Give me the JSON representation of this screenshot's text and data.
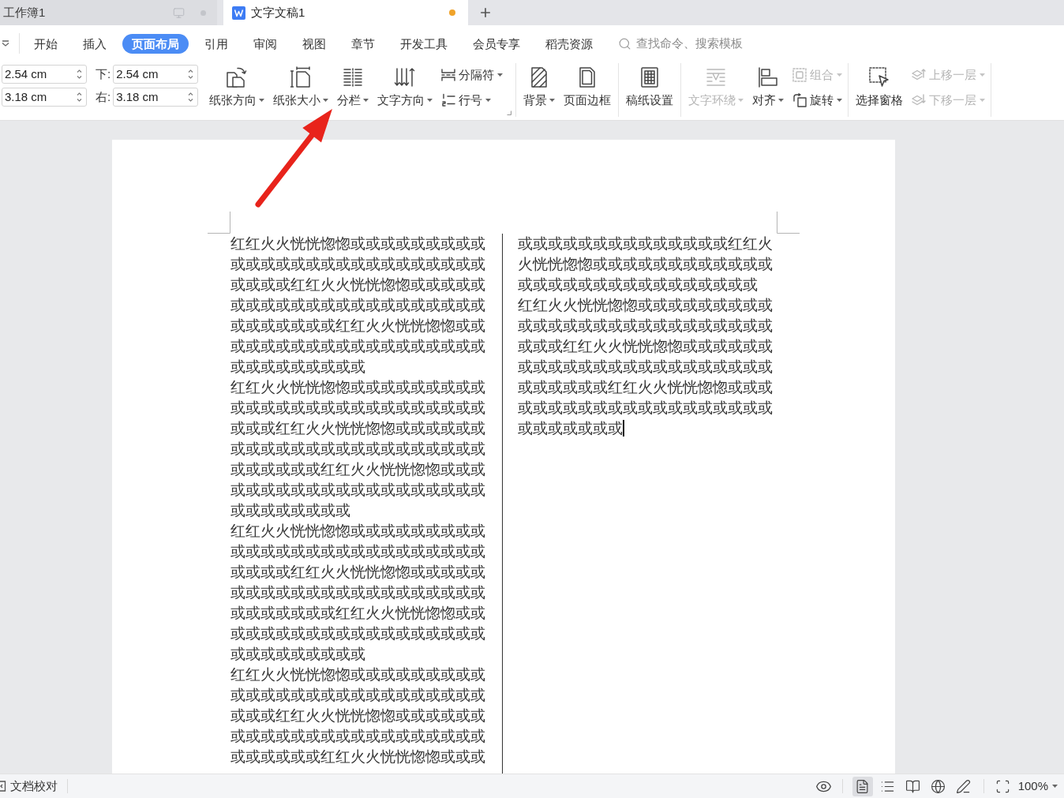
{
  "doc_tabs": [
    {
      "title": "工作簿1",
      "kind": "spreadsheet",
      "selected": false,
      "modified": false
    },
    {
      "title": "文字文稿1",
      "kind": "document",
      "selected": true,
      "modified": true
    }
  ],
  "ribbon_tabs": [
    {
      "label": "开始",
      "selected": false
    },
    {
      "label": "插入",
      "selected": false
    },
    {
      "label": "页面布局",
      "selected": true
    },
    {
      "label": "引用",
      "selected": false
    },
    {
      "label": "审阅",
      "selected": false
    },
    {
      "label": "视图",
      "selected": false
    },
    {
      "label": "章节",
      "selected": false
    },
    {
      "label": "开发工具",
      "selected": false
    },
    {
      "label": "会员专享",
      "selected": false
    },
    {
      "label": "稻壳资源",
      "selected": false
    }
  ],
  "search": {
    "placeholder": "查找命令、搜索模板"
  },
  "margins": [
    {
      "value": "2.54 cm"
    },
    {
      "value": "3.18 cm"
    },
    {
      "label": "下:",
      "value": "2.54 cm"
    },
    {
      "label": "右:",
      "value": "3.18 cm"
    }
  ],
  "ribbon_groups": [
    {
      "launcher": true,
      "items": [
        {
          "kind": "large",
          "label": "纸张方向",
          "dropdown": true,
          "disabled": false
        },
        {
          "kind": "large",
          "label": "纸张大小",
          "dropdown": true,
          "disabled": false
        },
        {
          "kind": "large",
          "label": "分栏",
          "dropdown": true,
          "disabled": false
        },
        {
          "kind": "large",
          "label": "文字方向",
          "dropdown": true,
          "disabled": false
        },
        {
          "kind": "small",
          "label": "分隔符",
          "dropdown": true,
          "disabled": false
        },
        {
          "kind": "small",
          "label": "行号",
          "dropdown": true,
          "disabled": false
        }
      ]
    },
    {
      "items": [
        {
          "kind": "large",
          "label": "背景",
          "dropdown": true,
          "disabled": false
        },
        {
          "kind": "large",
          "label": "页面边框",
          "dropdown": false,
          "disabled": false
        }
      ]
    },
    {
      "items": [
        {
          "kind": "large",
          "label": "稿纸设置",
          "dropdown": false,
          "disabled": false
        }
      ]
    },
    {
      "items": [
        {
          "kind": "large",
          "label": "文字环绕",
          "dropdown": true,
          "disabled": true
        },
        {
          "kind": "large",
          "label": "对齐",
          "dropdown": true,
          "disabled": false
        },
        {
          "kind": "small",
          "label": "组合",
          "dropdown": true,
          "disabled": true
        },
        {
          "kind": "small",
          "label": "旋转",
          "dropdown": true,
          "disabled": false
        }
      ]
    },
    {
      "items": [
        {
          "kind": "large",
          "label": "选择窗格",
          "dropdown": false,
          "disabled": false
        },
        {
          "kind": "small",
          "label": "上移一层",
          "dropdown": true,
          "disabled": true
        },
        {
          "kind": "small",
          "label": "下移一层",
          "dropdown": true,
          "disabled": true
        }
      ]
    }
  ],
  "document": {
    "columns": [
      {
        "caret": false,
        "paragraphs": [
          "红红火火恍恍惚惚或或或或或或或或或或或或或或或或或或或或或或或或或或或或或或红红火火恍恍惚惚或或或或或或或或或或或或或或或或或或或或或或或或或或或或或红红火火恍恍惚惚或或或或或或或或或或或或或或或或或或或或或或或或或或或或",
          "红红火火恍恍惚惚或或或或或或或或或或或或或或或或或或或或或或或或或或或或或红红火火恍恍惚惚或或或或或或或或或或或或或或或或或或或或或或或或或或或或或红红火火恍恍惚惚或或或或或或或或或或或或或或或或或或或或或或或或或或或或",
          "红红火火恍恍惚惚或或或或或或或或或或或或或或或或或或或或或或或或或或或或或或红红火火恍恍惚惚或或或或或或或或或或或或或或或或或或或或或或或或或或或或或红红火火恍恍惚惚或或或或或或或或或或或或或或或或或或或或或或或或或或或或",
          "红红火火恍恍惚惚或或或或或或或或或或或或或或或或或或或或或或或或或或或或或红红火火恍恍惚惚或或或或或或或或或或或或或或或或或或或或或或或或或或或或或红红火火恍恍惚惚或或或"
        ]
      },
      {
        "caret": true,
        "paragraphs": [
          "或或或或或或或或或或或或或或红红火火恍恍惚惚或或或或或或或或或或或或或或或或或或或或或或或或或或或或",
          "红红火火恍恍惚惚或或或或或或或或或或或或或或或或或或或或或或或或或或或或或红红火火恍恍惚惚或或或或或或或或或或或或或或或或或或或或或或或或或或或或或红红火火恍恍惚惚或或或或或或或或或或或或或或或或或或或或或或或或或或或"
        ]
      }
    ]
  },
  "status_bar": {
    "proofread": "文档校对",
    "views": [
      {
        "selected": true
      },
      {
        "selected": false
      },
      {
        "selected": false
      },
      {
        "selected": false
      },
      {
        "selected": false
      }
    ],
    "zoom": "100%"
  }
}
